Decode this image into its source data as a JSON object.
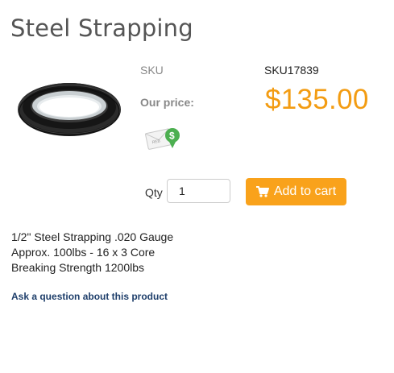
{
  "product": {
    "title": "Steel Strapping",
    "sku_label": "SKU",
    "sku_value": "SKU17839",
    "price_label": "Our price:",
    "price_value": "$135.00",
    "image_icon": "steel-strapping-coil-image",
    "rebate_icon": "rebate-envelope-dollar-icon"
  },
  "purchase": {
    "qty_label": "Qty",
    "qty_value": "1",
    "add_to_cart_label": "Add to cart",
    "cart_icon": "shopping-cart-icon"
  },
  "description": {
    "lines": [
      "1/2\" Steel Strapping .020 Gauge",
      "Approx. 100lbs - 16 x 3 Core",
      "Breaking Strength 1200lbs"
    ]
  },
  "links": {
    "ask_question": "Ask a question about this product"
  },
  "colors": {
    "title": "#555555",
    "price": "#f39c12",
    "button": "#f9a21b",
    "link": "#1f3f6b"
  }
}
